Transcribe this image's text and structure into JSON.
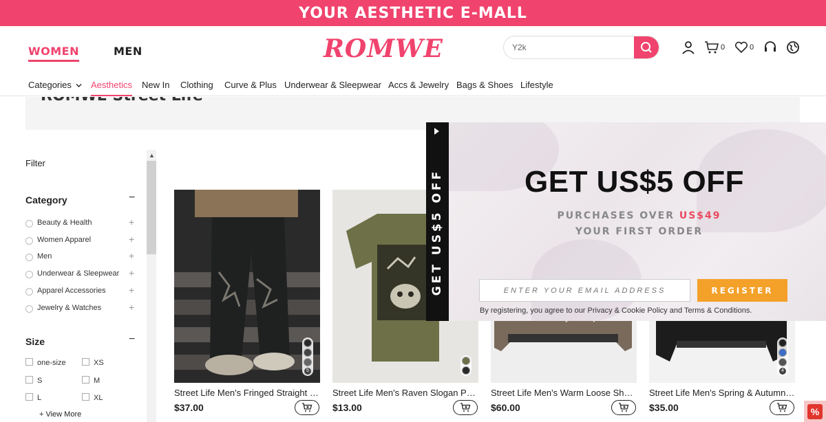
{
  "promo": {
    "text": "YOUR AESTHETIC E-MALL"
  },
  "header": {
    "women_tab": "WOMEN",
    "men_tab": "MEN",
    "logo": "ROMWE",
    "search_value": "Y2k",
    "cart_count": "0",
    "wishlist_count": "0",
    "icons": [
      "search-icon",
      "user-icon",
      "cart-icon",
      "heart-icon",
      "headset-icon",
      "globe-icon"
    ]
  },
  "nav": {
    "items": [
      "Categories",
      "Aesthetics",
      "New In",
      "Clothing",
      "Curve & Plus",
      "Underwear & Sleepwear",
      "Accs & Jewelry",
      "Bags & Shoes",
      "Lifestyle"
    ],
    "active": "Aesthetics"
  },
  "banner": {
    "title": "ROMWE Street Life"
  },
  "sidebar": {
    "filter_label": "Filter",
    "category_title": "Category",
    "category_toggle": "−",
    "categories": [
      "Beauty & Health",
      "Women Apparel",
      "Men",
      "Underwear & Sleepwear",
      "Apparel Accessories",
      "Jewelry & Watches"
    ],
    "size_title": "Size",
    "size_toggle": "−",
    "sizes": [
      "one-size",
      "XS",
      "S",
      "M",
      "L",
      "XL"
    ],
    "view_more": "+ View More"
  },
  "products": [
    {
      "title": "Street Life Men's Fringed Straight Leg Jeans",
      "price": "$37.00",
      "swatch_count": "5"
    },
    {
      "title": "Street Life Men's Raven Slogan Print Tee",
      "price": "$13.00",
      "swatch_count": ""
    },
    {
      "title": "Street Life Men's Warm Loose Short Jacket",
      "price": "$60.00",
      "swatch_count": ""
    },
    {
      "title": "Street Life Men's Spring & Autumn Jacket",
      "price": "$35.00",
      "swatch_count": "4"
    }
  ],
  "popup": {
    "tab_text": "GET US$5 OFF",
    "headline": "GET US$5 OFF",
    "sub1_prefix": "PURCHASES OVER ",
    "sub1_amount": "US$49",
    "sub2": "YOUR FIRST ORDER",
    "email_placeholder": "ENTER YOUR EMAIL ADDRESS",
    "register": "REGISTER",
    "terms": "By registering, you agree to our Privacy & Cookie Policy and Terms & Conditions."
  },
  "discount_badge": "%",
  "colors": {
    "brand": "#f0436d",
    "register": "#f4a12a",
    "promo_amount": "#e94a5f"
  }
}
